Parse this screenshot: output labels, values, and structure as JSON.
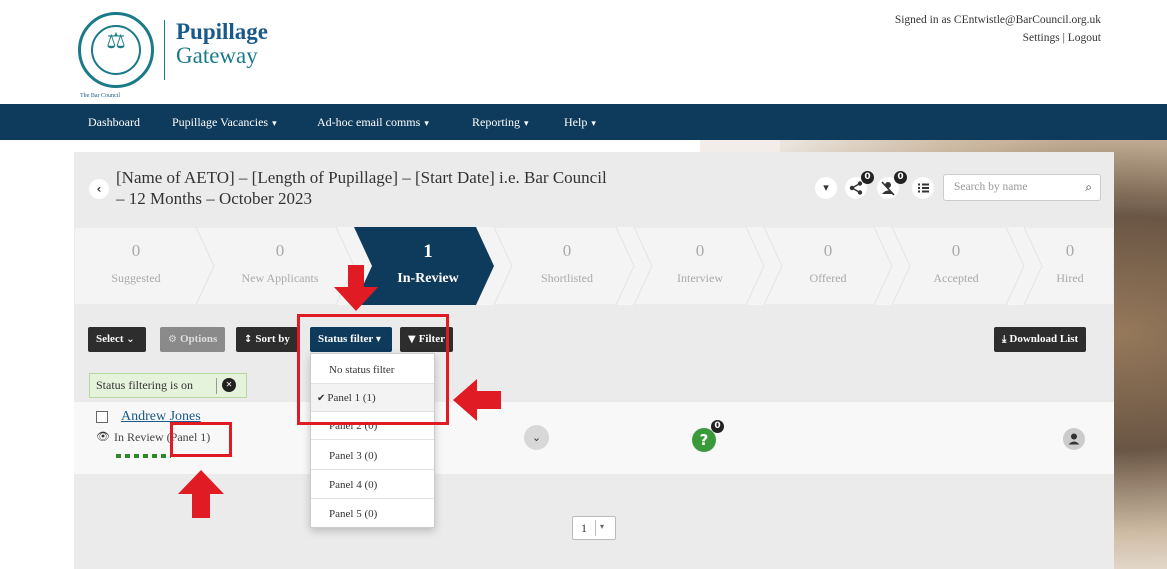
{
  "header": {
    "brand_line1": "Pupillage",
    "brand_line2": "Gateway",
    "logo_caption": "The Bar Council",
    "signed_in": "Signed in as CEntwistle@BarCouncil.org.uk",
    "settings_link": "Settings",
    "separator": "|",
    "logout_link": "Logout"
  },
  "nav": {
    "items": [
      {
        "label": "Dashboard"
      },
      {
        "label": "Pupillage Vacancies"
      },
      {
        "label": "Ad-hoc email comms"
      },
      {
        "label": "Reporting"
      },
      {
        "label": "Help"
      }
    ],
    "caret": "▾"
  },
  "vacancy": {
    "back_glyph": "‹",
    "title": "[Name of AETO] – [Length of Pupillage] – [Start Date] i.e. Bar Council – 12 Months – October 2023"
  },
  "actions": {
    "more_glyph": "▾",
    "share_badge": "0",
    "unassigned_badge": "0",
    "search_placeholder": "Search by name",
    "search_glyph": "⌕"
  },
  "pipeline": [
    {
      "count": "0",
      "label": "Suggested"
    },
    {
      "count": "0",
      "label": "New Applicants"
    },
    {
      "count": "1",
      "label": "In-Review",
      "active": true
    },
    {
      "count": "0",
      "label": "Shortlisted"
    },
    {
      "count": "0",
      "label": "Interview"
    },
    {
      "count": "0",
      "label": "Offered"
    },
    {
      "count": "0",
      "label": "Accepted"
    },
    {
      "count": "0",
      "label": "Hired"
    }
  ],
  "toolbar": {
    "select_label": "Select",
    "options_label": "Options",
    "sort_label": "Sort by",
    "status_filter_label": "Status filter",
    "filter_label": "Filter",
    "download_label": "Download List"
  },
  "filter_note": {
    "text": "Status filtering is on",
    "clear_glyph": "✕"
  },
  "applicant": {
    "name": "Andrew Jones",
    "status": "In Review (Panel 1)",
    "question_badge": "0",
    "question_glyph": "?"
  },
  "status_filter_menu": [
    {
      "label": "No status filter",
      "selected": false
    },
    {
      "label": "Panel 1 (1)",
      "selected": true
    },
    {
      "label": "Panel 2 (0)",
      "selected": false
    },
    {
      "label": "Panel 3 (0)",
      "selected": false
    },
    {
      "label": "Panel 4 (0)",
      "selected": false
    },
    {
      "label": "Panel 5 (0)",
      "selected": false
    }
  ],
  "pagination": {
    "page": "1",
    "caret": "▾"
  },
  "colors": {
    "navy": "#0e3a5c",
    "teal": "#1a7a8a",
    "annotation_red": "#e01b24",
    "success_green": "#3a9a3a"
  }
}
